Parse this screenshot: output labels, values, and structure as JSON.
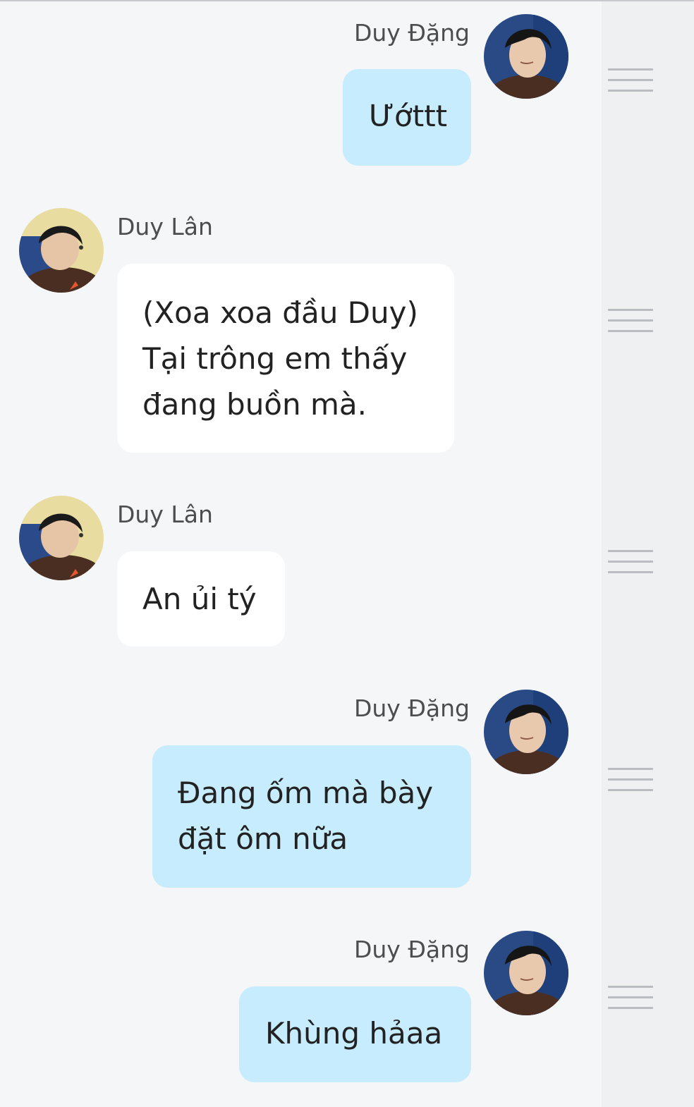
{
  "participants": {
    "me": {
      "name": "Duy Đặng",
      "avatar": "avatar-photo-duy-dang"
    },
    "other": {
      "name": "Duy Lân",
      "avatar": "avatar-photo-duy-lan"
    }
  },
  "colors": {
    "background": "#f5f6f8",
    "my_bubble": "#c7ecfd",
    "other_bubble": "#ffffff",
    "text": "#222222",
    "sender_name": "#4d4d4d",
    "side_rail": "#eef0f2",
    "handle": "#b9bcc0"
  },
  "messages": [
    {
      "sender": "Duy Đặng",
      "side": "right",
      "lines": [
        "Ướttt"
      ]
    },
    {
      "sender": "Duy Lân",
      "side": "left",
      "lines": [
        "(Xoa xoa đầu Duy)",
        "Tại trông em thấy",
        "đang buồn mà."
      ]
    },
    {
      "sender": "Duy Lân",
      "side": "left",
      "lines": [
        "An ủi tý"
      ]
    },
    {
      "sender": "Duy Đặng",
      "side": "right",
      "lines": [
        "Đang ốm mà bày",
        "đặt ôm nữa"
      ]
    },
    {
      "sender": "Duy Đặng",
      "side": "right",
      "lines": [
        "Khùng hảaa"
      ]
    }
  ],
  "icons": {
    "drag_handle": "drag-handle-icon"
  }
}
